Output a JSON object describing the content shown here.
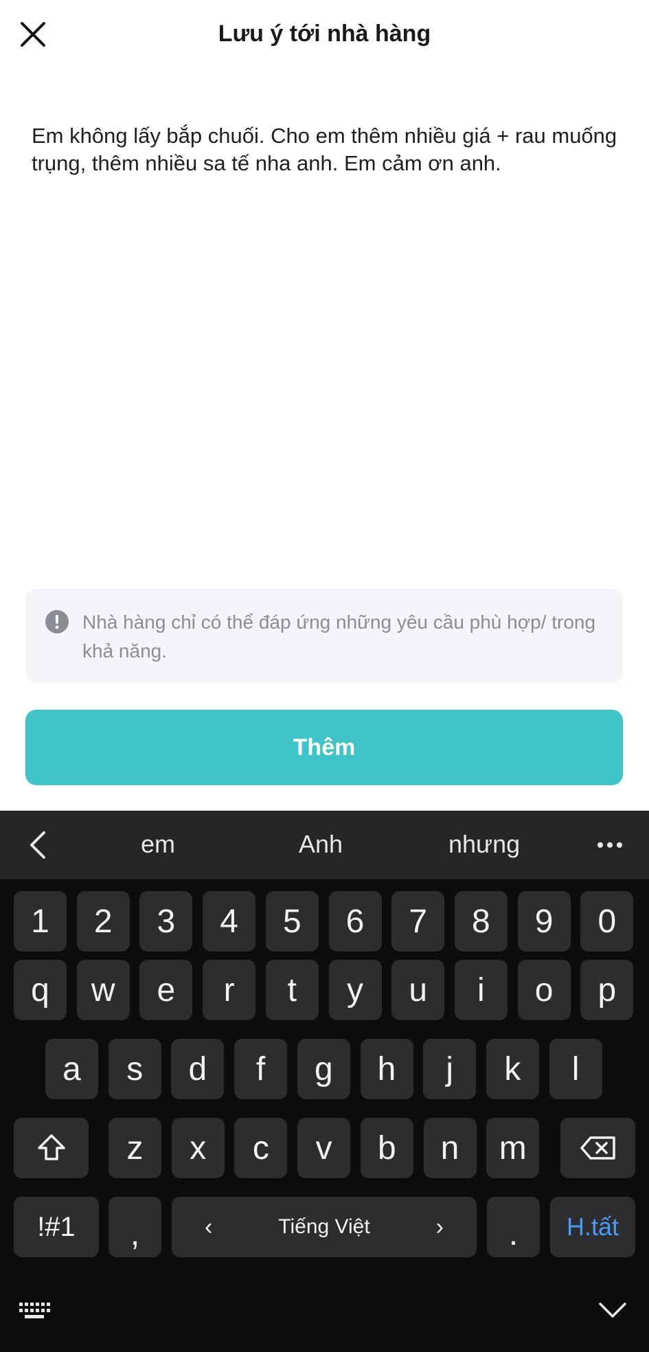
{
  "header": {
    "title": "Lưu ý tới nhà hàng",
    "close_icon": "close-icon"
  },
  "note": {
    "text": "Em không lấy bắp chuối. Cho em thêm nhiều giá + rau muống trụng, thêm nhiều sa tế nha anh. Em cảm ơn anh."
  },
  "info": {
    "icon": "exclamation-circle-icon",
    "text": "Nhà hàng chỉ có thể đáp ứng những yêu cầu phù hợp/ trong khả năng."
  },
  "add_button": {
    "label": "Thêm",
    "color": "#3ec4c8"
  },
  "keyboard": {
    "suggestions": [
      "em",
      "Anh",
      "nhưng"
    ],
    "row_numbers": [
      "1",
      "2",
      "3",
      "4",
      "5",
      "6",
      "7",
      "8",
      "9",
      "0"
    ],
    "row_1": [
      "q",
      "w",
      "e",
      "r",
      "t",
      "y",
      "u",
      "i",
      "o",
      "p"
    ],
    "row_2": [
      "a",
      "s",
      "d",
      "f",
      "g",
      "h",
      "j",
      "k",
      "l"
    ],
    "row_3": [
      "z",
      "x",
      "c",
      "v",
      "b",
      "n",
      "m"
    ],
    "symbols_label": "!#1",
    "comma": ",",
    "space_label": "Tiếng Việt",
    "space_left_arrow": "‹",
    "space_right_arrow": "›",
    "period": ".",
    "done_label": "H.tất",
    "done_color": "#4a9cf2"
  }
}
